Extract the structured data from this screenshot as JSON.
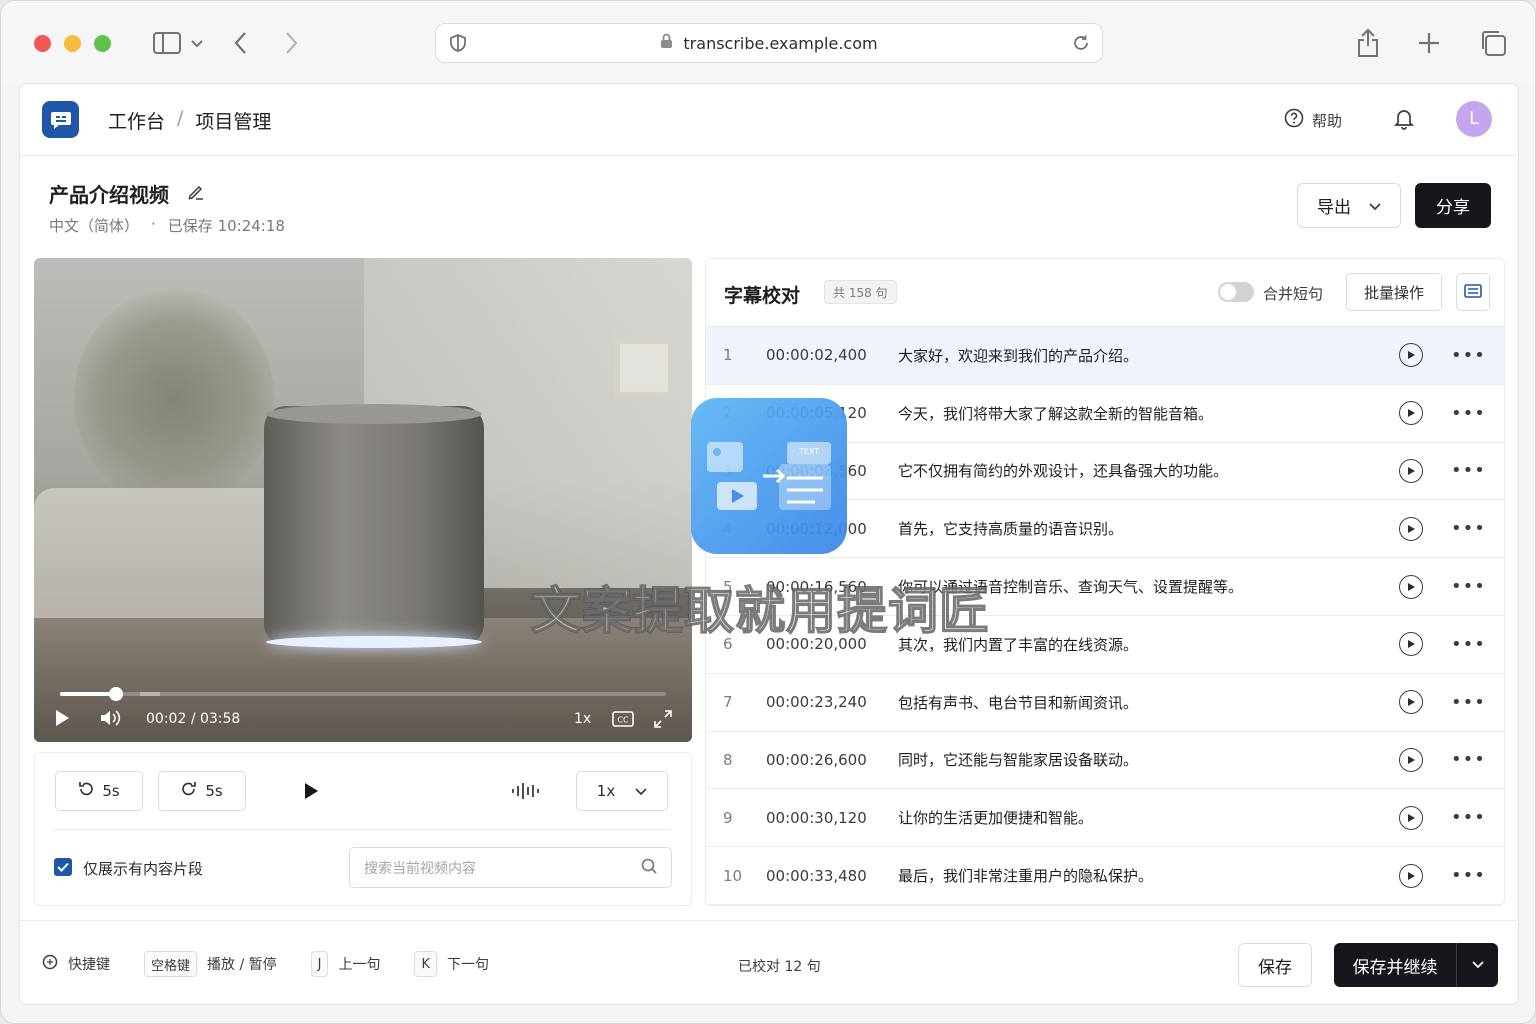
{
  "browser": {
    "url": "transcribe.example.com"
  },
  "nav": {
    "crumbs": [
      "工作台",
      "/",
      "项目管理"
    ],
    "help": "帮助",
    "avatar": "L"
  },
  "project": {
    "title": "产品介绍视频",
    "language": "中文（简体）",
    "dot": "·",
    "saved": "已保存 10:24:18",
    "export": "导出",
    "share": "分享"
  },
  "video": {
    "current": "00:02",
    "sep": "/",
    "total": "03:58",
    "rate": "1x",
    "progress": 0.009
  },
  "player": {
    "back": "5s",
    "forward": "5s",
    "rate": "1x",
    "filter_label": "仅展示有内容片段",
    "filter_checked": true,
    "search_placeholder": "搜索当前视频内容"
  },
  "subtitles": {
    "title": "字幕校对",
    "count": "共 158 句",
    "merge_label": "合并短句",
    "batch": "批量操作",
    "rows": [
      {
        "num": "1",
        "time": "00:00:02,400",
        "text": "大家好，欢迎来到我们的产品介绍。"
      },
      {
        "num": "2",
        "time": "00:00:05,120",
        "text": "今天，我们将带大家了解这款全新的智能音箱。"
      },
      {
        "num": "3",
        "time": "00:00:08,560",
        "text": "它不仅拥有简约的外观设计，还具备强大的功能。"
      },
      {
        "num": "4",
        "time": "00:00:12,000",
        "text": "首先，它支持高质量的语音识别。"
      },
      {
        "num": "5",
        "time": "00:00:16,560",
        "text": "你可以通过语音控制音乐、查询天气、设置提醒等。"
      },
      {
        "num": "6",
        "time": "00:00:20,000",
        "text": "其次，我们内置了丰富的在线资源。"
      },
      {
        "num": "7",
        "time": "00:00:23,240",
        "text": "包括有声书、电台节目和新闻资讯。"
      },
      {
        "num": "8",
        "time": "00:00:26,600",
        "text": "同时，它还能与智能家居设备联动。"
      },
      {
        "num": "9",
        "time": "00:00:30,120",
        "text": "让你的生活更加便捷和智能。"
      },
      {
        "num": "10",
        "time": "00:00:33,480",
        "text": "最后，我们非常注重用户的隐私保护。"
      }
    ]
  },
  "footer": {
    "shortcuts_label": "快捷键",
    "space_key": "空格键",
    "play_pause": "播放 / 暂停",
    "prev_key": "J",
    "prev_label": "上一句",
    "next_key": "K",
    "next_label": "下一句",
    "checked": "已校对 12 句",
    "save": "保存",
    "save_continue": "保存并继续"
  },
  "watermark": {
    "text": "文案提取就用提词匠",
    "badge_text": "TEXT"
  },
  "colors": {
    "accent": "#1f56a8",
    "dark": "#15171c",
    "active_row": "#eef3fc"
  }
}
